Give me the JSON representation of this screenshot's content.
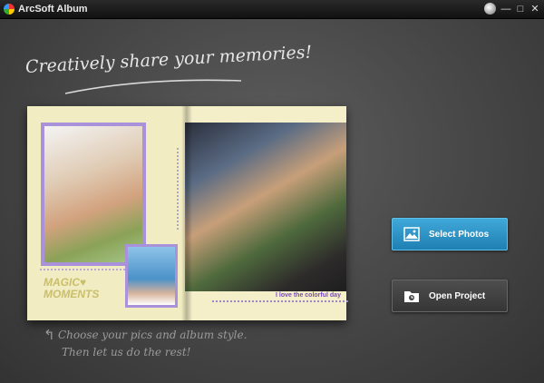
{
  "window": {
    "title": "ArcSoft Album",
    "minimize_glyph": "—",
    "maximize_glyph": "□",
    "close_glyph": "✕"
  },
  "hero": {
    "tagline": "Creatively share your memories!"
  },
  "album_preview": {
    "left_badge": "MAGIC♥ MOMENTS",
    "right_caption": "I love the colorful day"
  },
  "hint": {
    "line1": "Choose your pics and album style.",
    "line2": "Then let us do the rest!"
  },
  "actions": {
    "select_photos": "Select Photos",
    "open_project": "Open Project"
  },
  "icons": {
    "app": "arcsoft-logo-icon",
    "globe": "globe-icon",
    "photo": "image-icon",
    "folder": "folder-icon",
    "arrow": "curved-arrow-icon"
  },
  "colors": {
    "accent": "#2e93c6",
    "frame": "#a992d9",
    "background": "#4a4a4a"
  }
}
